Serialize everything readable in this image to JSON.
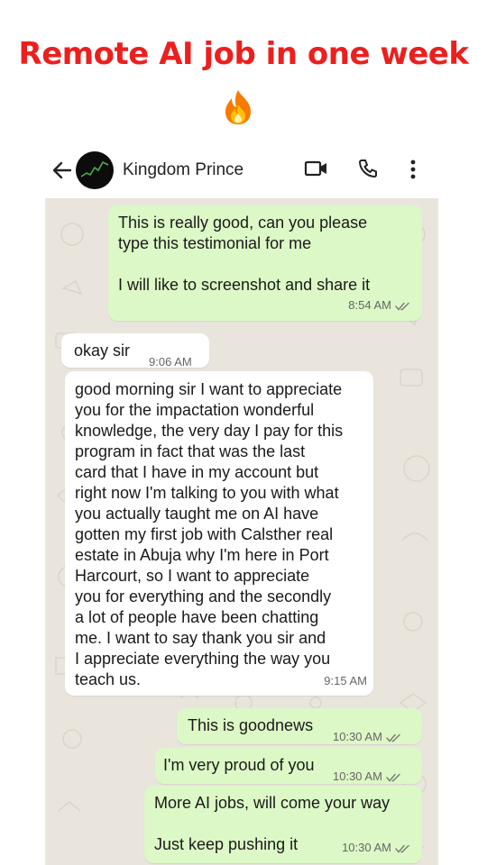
{
  "headline": "Remote AI job in one week",
  "contact": {
    "name": "Kingdom Prince"
  },
  "messages": [
    {
      "dir": "out",
      "lines": [
        "This is really good, can you please",
        "type this testimonial for me",
        "",
        "I will like to screenshot and share it"
      ],
      "time": "8:54 AM",
      "read": true
    },
    {
      "dir": "in",
      "lines": [
        "okay sir"
      ],
      "time": "9:06 AM"
    },
    {
      "dir": "in",
      "lines": [
        "good morning sir I want to appreciate",
        "you for the impactation wonderful",
        "knowledge, the very day I pay for this",
        "program in fact that was the last",
        "card that I have in my account but",
        "right now I'm talking to you with what",
        "you actually taught me on AI have",
        "gotten my first job with Calsther real",
        "estate in Abuja why I'm here in Port",
        "Harcourt, so I want to appreciate",
        "you for everything and the secondly",
        "a lot of people have been chatting",
        "me. I want to say thank you sir and",
        "I appreciate everything the way you",
        "teach us."
      ],
      "time": "9:15 AM"
    },
    {
      "dir": "out",
      "lines": [
        "This is goodnews"
      ],
      "time": "10:30 AM",
      "read": true
    },
    {
      "dir": "out",
      "lines": [
        "I'm very proud of you"
      ],
      "time": "10:30 AM",
      "read": true
    },
    {
      "dir": "out",
      "lines": [
        "More AI jobs, will come your way",
        "",
        "Just keep pushing it"
      ],
      "time": "10:30 AM",
      "read": true
    }
  ],
  "colors": {
    "headline": "#ec1f1f",
    "outgoing": "#dcf8c6",
    "incoming": "#ffffff",
    "wallpaper": "#e9e5dd",
    "read_ticks": "#7a7a7a"
  },
  "icons": [
    "back-arrow-icon",
    "video-call-icon",
    "phone-icon",
    "more-vertical-icon",
    "fire-emoji-icon",
    "double-check-icon"
  ]
}
